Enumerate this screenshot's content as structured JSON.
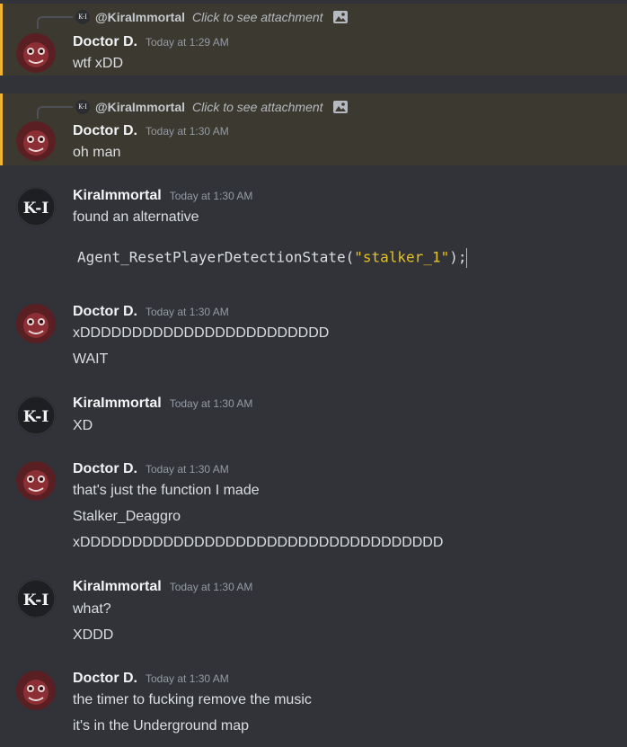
{
  "users": {
    "doctor": {
      "name": "Doctor D."
    },
    "kira": {
      "name": "KiraImmortal",
      "avatar_text": "K-I"
    }
  },
  "reply_ref": {
    "mention": "@KiraImmortal",
    "text": "Click to see attachment",
    "icon": "image-icon"
  },
  "messages": [
    {
      "author": "Doctor D.",
      "time": "Today at 1:29 AM",
      "lines": [
        "wtf xDD"
      ]
    },
    {
      "author": "Doctor D.",
      "time": "Today at 1:30 AM",
      "lines": [
        "oh man"
      ]
    },
    {
      "author": "KiraImmortal",
      "time": "Today at 1:30 AM",
      "lines": [
        "found an alternative"
      ],
      "code": {
        "fn": "Agent_ResetPlayerDetectionState(",
        "str": "\"stalker_1\"",
        "end": ");"
      }
    },
    {
      "author": "Doctor D.",
      "time": "Today at 1:30 AM",
      "lines": [
        "xDDDDDDDDDDDDDDDDDDDDDDDD",
        "WAIT"
      ]
    },
    {
      "author": "KiraImmortal",
      "time": "Today at 1:30 AM",
      "lines": [
        "XD"
      ]
    },
    {
      "author": "Doctor D.",
      "time": "Today at 1:30 AM",
      "lines": [
        "that's just the function I made",
        "Stalker_Deaggro",
        "xDDDDDDDDDDDDDDDDDDDDDDDDDDDDDDDDDDD"
      ]
    },
    {
      "author": "KiraImmortal",
      "time": "Today at 1:30 AM",
      "lines": [
        "what?",
        "XDDD"
      ]
    },
    {
      "author": "Doctor D.",
      "time": "Today at 1:30 AM",
      "lines": [
        "the timer to fucking remove the music",
        "it's in the Underground map"
      ]
    }
  ],
  "colors": {
    "background": "#313338",
    "highlight": "#3c3930",
    "mention_bar": "#f0b232",
    "code_string": "#e5c224"
  }
}
